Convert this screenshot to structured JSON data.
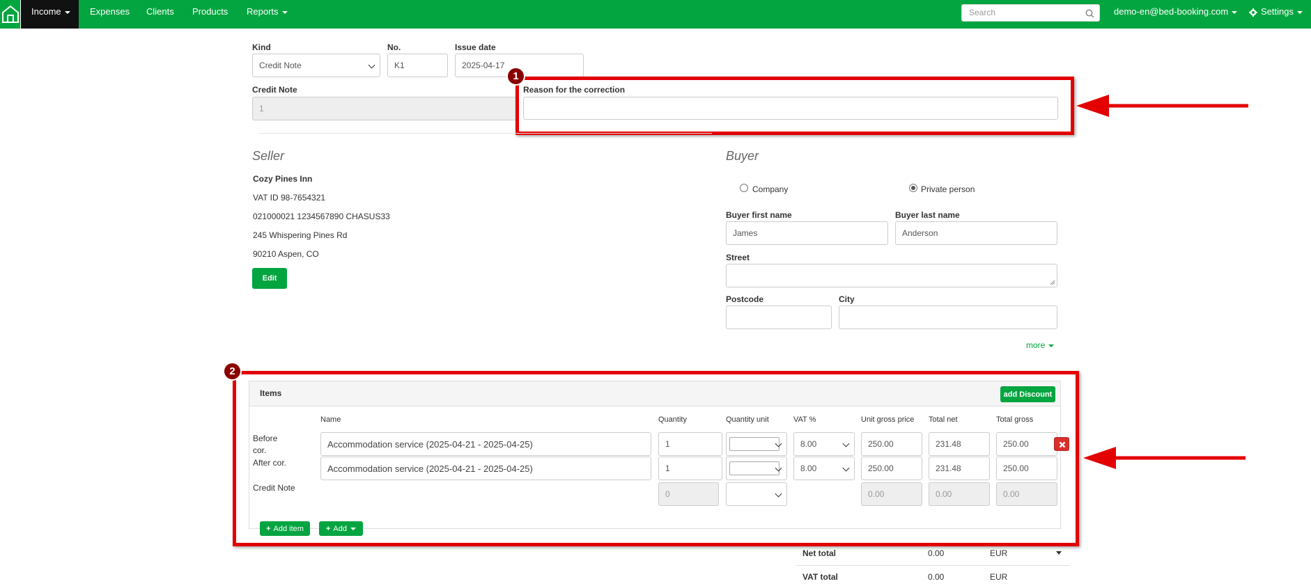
{
  "nav": {
    "items": [
      "Income",
      "Expenses",
      "Clients",
      "Products",
      "Reports"
    ],
    "search_placeholder": "Search",
    "user": "demo-en@bed-booking.com",
    "settings": "Settings"
  },
  "header_form": {
    "kind_label": "Kind",
    "kind_value": "Credit Note",
    "no_label": "No.",
    "no_value": "K1",
    "issue_date_label": "Issue date",
    "issue_date_value": "2025-04-17",
    "credit_note_label": "Credit Note",
    "credit_note_value": "1",
    "reason_label": "Reason for the correction",
    "reason_value": ""
  },
  "badges": [
    "1",
    "2"
  ],
  "seller": {
    "heading": "Seller",
    "name": "Cozy Pines Inn",
    "vat": "VAT ID 98-7654321",
    "bank": "021000021 1234567890 CHASUS33",
    "street": "245 Whispering Pines Rd",
    "city": "90210 Aspen, CO",
    "edit_label": "Edit"
  },
  "buyer": {
    "heading": "Buyer",
    "company_label": "Company",
    "private_label": "Private person",
    "first_name_label": "Buyer first name",
    "first_name_value": "James",
    "last_name_label": "Buyer last name",
    "last_name_value": "Anderson",
    "street_label": "Street",
    "postcode_label": "Postcode",
    "city_label": "City",
    "more_label": "more"
  },
  "items": {
    "title": "Items",
    "add_discount": "add Discount",
    "columns": [
      "Name",
      "Quantity",
      "Quantity unit",
      "VAT %",
      "Unit gross price",
      "Total net",
      "Total gross"
    ],
    "row_labels": [
      "Before cor.",
      "After cor.",
      "Credit Note"
    ],
    "before": {
      "name": "Accommodation service (2025-04-21 - 2025-04-25)",
      "qty": "1",
      "vat": "8.00",
      "unit_gross": "250.00",
      "total_net": "231.48",
      "total_gross": "250.00"
    },
    "after": {
      "name": "Accommodation service (2025-04-21 - 2025-04-25)",
      "qty": "1",
      "vat": "8.00",
      "unit_gross": "250.00",
      "total_net": "231.48",
      "total_gross": "250.00"
    },
    "credit": {
      "qty": "0",
      "unit_gross": "0.00",
      "total_net": "0.00",
      "total_gross": "0.00"
    },
    "add_item": "Add item",
    "add": "Add"
  },
  "totals": {
    "net_label": "Net total",
    "net_value": "0.00",
    "net_currency": "EUR",
    "vat_label": "VAT total",
    "vat_value": "0.00",
    "vat_currency": "EUR"
  }
}
